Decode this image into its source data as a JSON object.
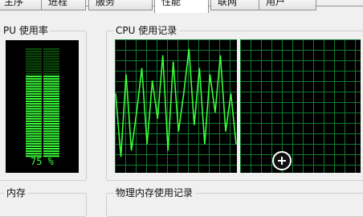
{
  "tabs": [
    {
      "label": "应用程序",
      "visible": "主序"
    },
    {
      "label": "进程"
    },
    {
      "label": "服务"
    },
    {
      "label": "性能"
    },
    {
      "label": "联网"
    },
    {
      "label": "用户"
    }
  ],
  "cpu_usage": {
    "title": "CPU 使用率",
    "title_visible": "PU 使用率",
    "percent": 75,
    "label": "75 %"
  },
  "cpu_history": {
    "title": "CPU 使用记录"
  },
  "memory": {
    "title": "内存"
  },
  "physical_memory_history": {
    "title": "物理内存使用记录"
  },
  "colors": {
    "graph_line": "#39ff39",
    "grid": "#0e7a32",
    "meter_on": "#39ff39",
    "meter_off": "#0a4d0a",
    "background": "#f0f0f0"
  },
  "chart_data": [
    {
      "type": "line",
      "series": [
        {
          "values": [
            60,
            10,
            75,
            15,
            45,
            80,
            20,
            70,
            40,
            90,
            15,
            85,
            30,
            60,
            95,
            35,
            80,
            20,
            75,
            45,
            90,
            30,
            60,
            20
          ]
        }
      ],
      "ylim": [
        0,
        100
      ],
      "grid": true
    },
    {
      "type": "line",
      "series": [
        {
          "values": []
        }
      ],
      "ylim": [
        0,
        100
      ],
      "grid": true
    }
  ]
}
